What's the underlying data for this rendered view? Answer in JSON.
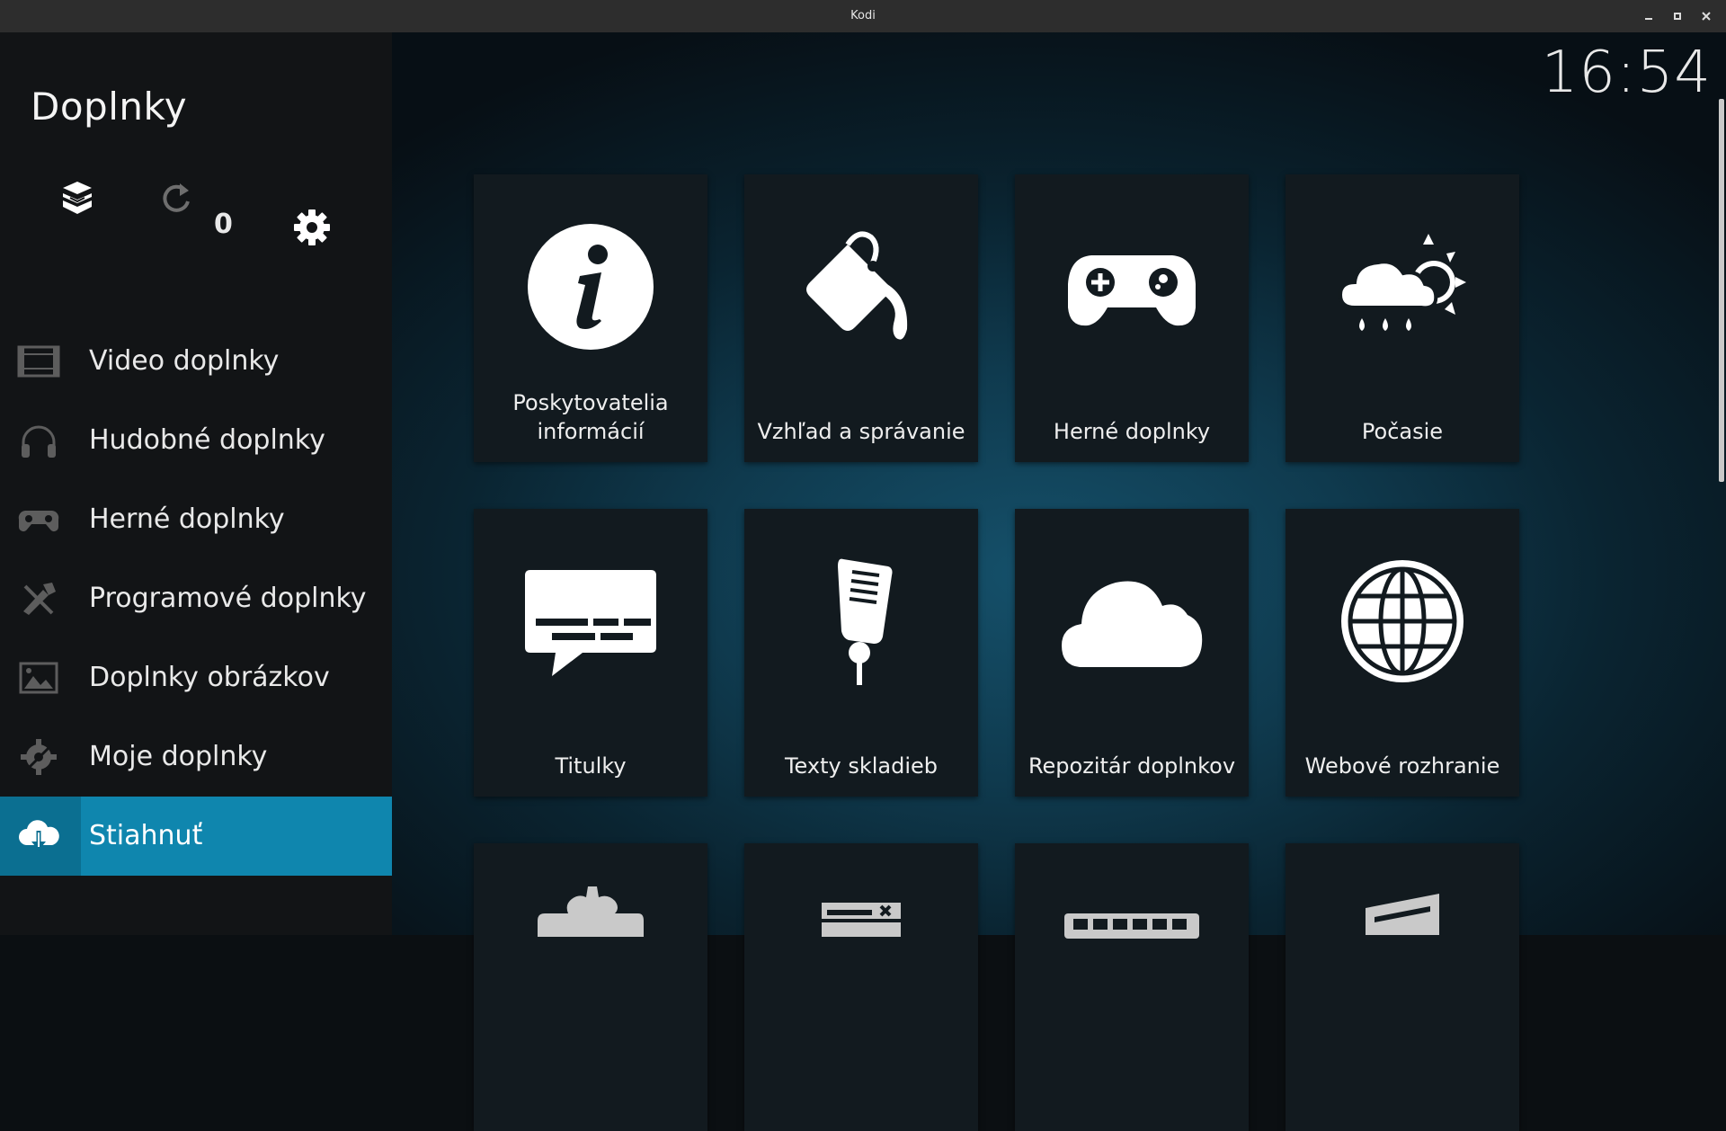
{
  "window": {
    "title": "Kodi"
  },
  "sidebar": {
    "title": "Doplnky",
    "update_count": "0",
    "items": [
      {
        "label": "Video doplnky",
        "icon": "film-icon"
      },
      {
        "label": "Hudobné doplnky",
        "icon": "headphones-icon"
      },
      {
        "label": "Herné doplnky",
        "icon": "gamepad-icon"
      },
      {
        "label": "Programové doplnky",
        "icon": "tools-icon"
      },
      {
        "label": "Doplnky obrázkov",
        "icon": "image-icon"
      },
      {
        "label": "Moje doplnky",
        "icon": "gear-tools-icon"
      },
      {
        "label": "Stiahnuť",
        "icon": "cloud-download-icon",
        "active": true
      }
    ]
  },
  "clock": "16:54",
  "tiles": [
    {
      "label": "Poskytovatelia informácií",
      "icon": "info-icon"
    },
    {
      "label": "Vzhľad a správanie",
      "icon": "paint-bucket-icon"
    },
    {
      "label": "Herné doplnky",
      "icon": "gamepad-icon"
    },
    {
      "label": "Počasie",
      "icon": "weather-icon"
    },
    {
      "label": "Titulky",
      "icon": "subtitles-icon"
    },
    {
      "label": "Texty skladieb",
      "icon": "microphone-icon"
    },
    {
      "label": "Repozitár doplnkov",
      "icon": "cloud-icon"
    },
    {
      "label": "Webové rozhranie",
      "icon": "globe-icon"
    },
    {
      "label": "",
      "icon": "puzzle-icon"
    },
    {
      "label": "",
      "icon": "screensaver-icon"
    },
    {
      "label": "",
      "icon": "keyboard-icon"
    },
    {
      "label": "",
      "icon": "music-icon"
    }
  ],
  "colors": {
    "accent": "#0f86ae",
    "sidebar": "#121416",
    "tile": "#121a1f"
  }
}
